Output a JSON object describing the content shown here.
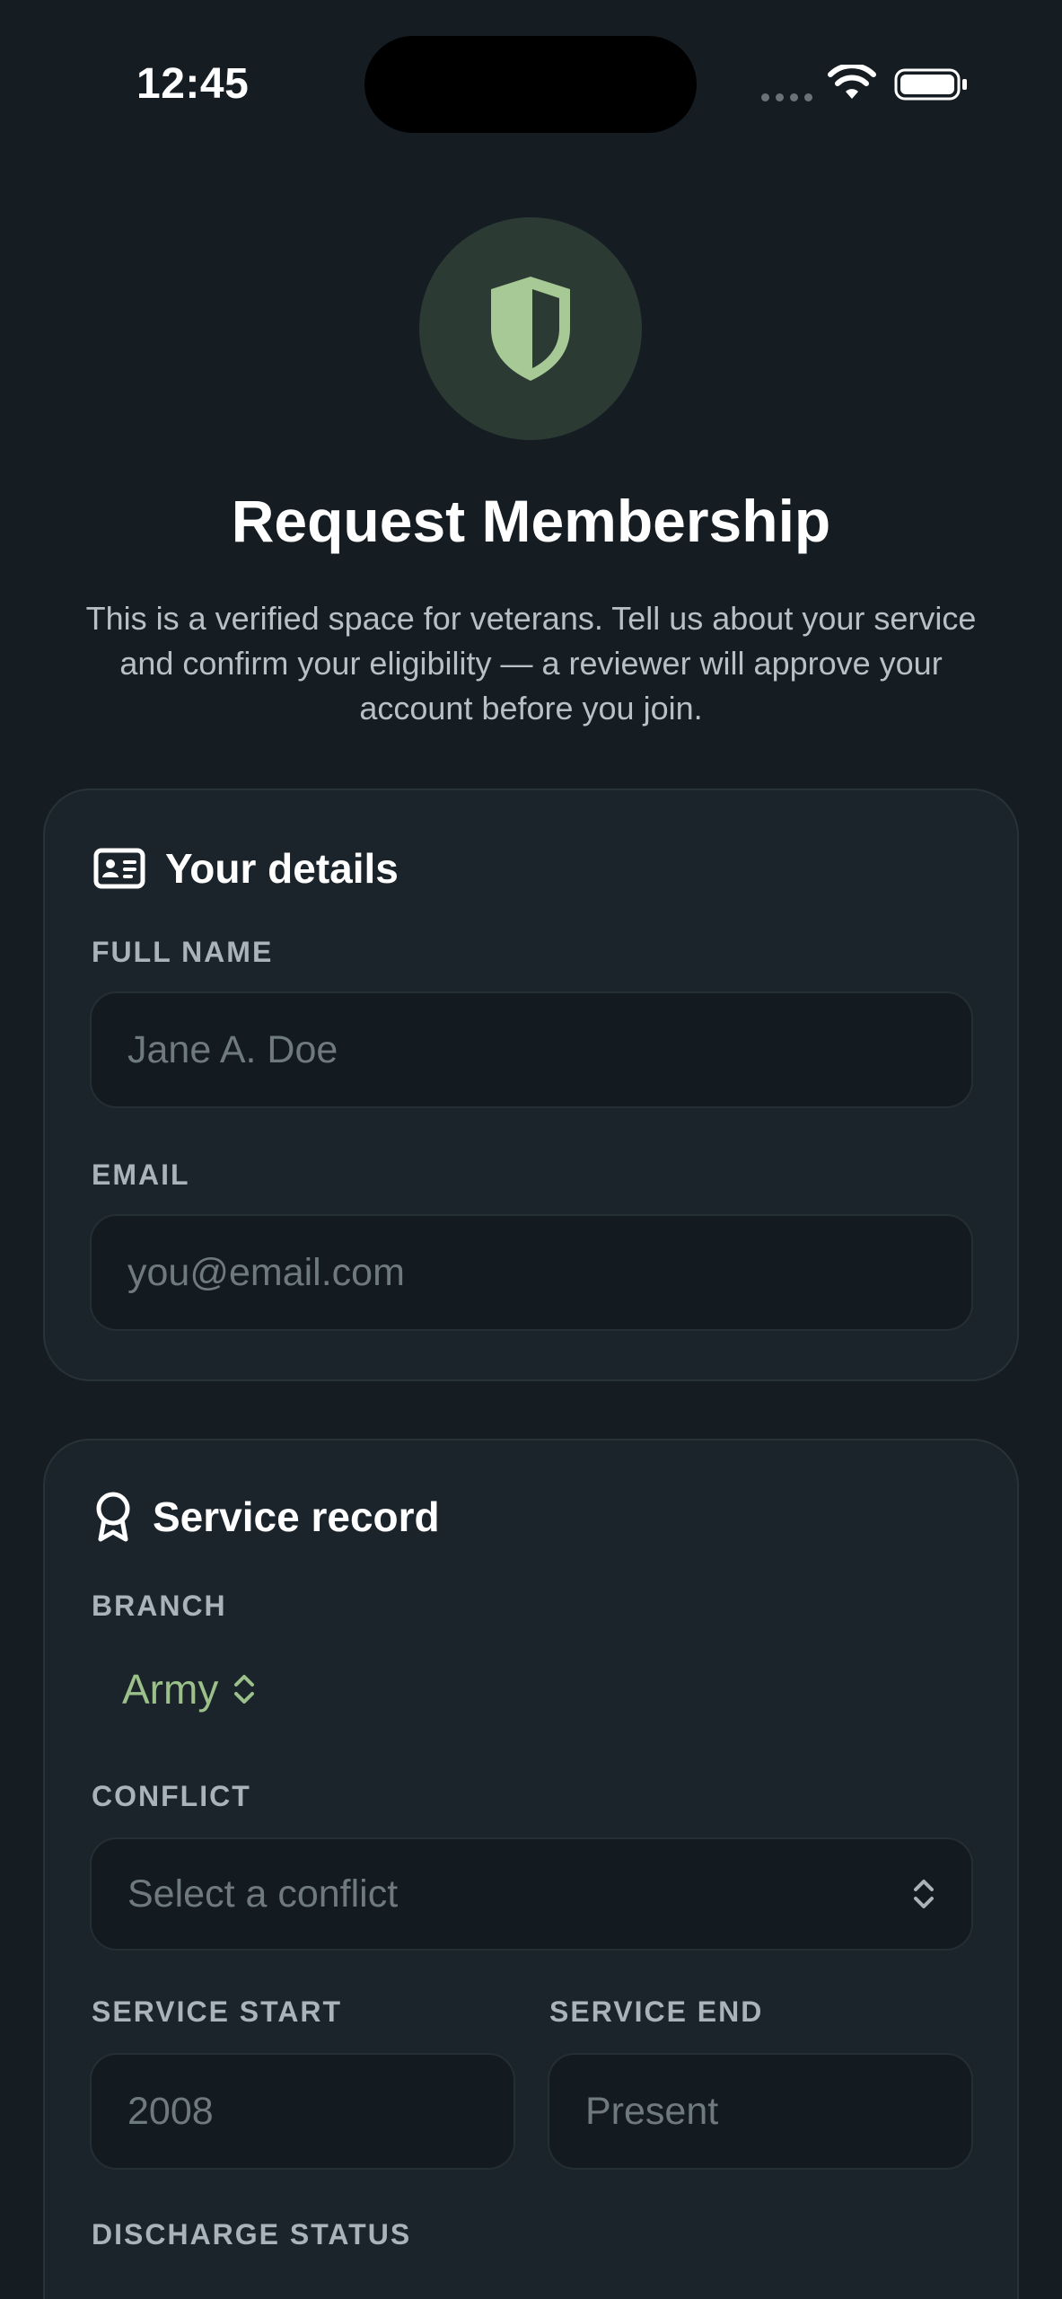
{
  "status_bar": {
    "time": "12:45"
  },
  "header": {
    "badge_icon": "shield-icon",
    "title": "Request Membership",
    "subtitle": "This is a verified space for veterans. Tell us about your service and confirm your eligibility — a reviewer will approve your account before you join."
  },
  "details": {
    "icon": "id-card-icon",
    "title": "Your details",
    "full_name_label": "FULL NAME",
    "full_name_placeholder": "Jane A. Doe",
    "email_label": "EMAIL",
    "email_placeholder": "you@email.com"
  },
  "service": {
    "icon": "award-ribbon-icon",
    "title": "Service record",
    "branch_label": "BRANCH",
    "branch_value": "Army",
    "conflict_label": "CONFLICT",
    "conflict_placeholder": "Select a conflict",
    "start_label": "SERVICE START",
    "start_placeholder": "2008",
    "end_label": "SERVICE END",
    "end_placeholder": "Present",
    "discharge_label": "DISCHARGE STATUS"
  },
  "colors": {
    "background": "#151d23",
    "card": "#1b242b",
    "accent_green": "#9bc08a",
    "badge_bg": "#2c3a34"
  }
}
